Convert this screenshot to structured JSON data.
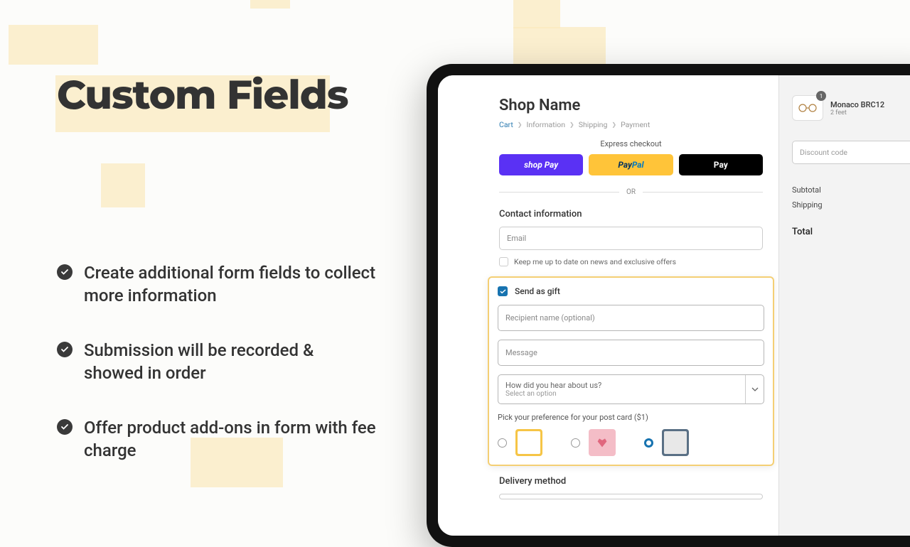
{
  "hero": {
    "title": "Custom Fields"
  },
  "bullets": [
    "Create additional form fields to collect more information",
    "Submission will be recorded & showed in order",
    "Offer product add-ons in form with fee charge"
  ],
  "checkout": {
    "shop_name": "Shop Name",
    "breadcrumb": {
      "cart": "Cart",
      "info": "Information",
      "shipping": "Shipping",
      "payment": "Payment"
    },
    "express_title": "Express checkout",
    "buttons": {
      "shoppay": "shop Pay",
      "paypal_p1": "Pay",
      "paypal_p2": "Pal",
      "applepay": "Pay"
    },
    "or": "OR",
    "contact_title": "Contact information",
    "email_placeholder": "Email",
    "news_label": "Keep me up to date on news and exclusive offers",
    "gift": {
      "title": "Send as gift",
      "recipient_placeholder": "Recipient name (optional)",
      "message_placeholder": "Message",
      "how_label": "How did you hear about us?",
      "how_value": "Select an option",
      "postcard_label": "Pick your preference for your post card ($1)"
    },
    "delivery_title": "Delivery method"
  },
  "order": {
    "product_name": "Monaco BRC12",
    "product_sub": "2 feet",
    "qty": "1",
    "discount_placeholder": "Discount code",
    "subtotal_label": "Subtotal",
    "shipping_label": "Shipping",
    "total_label": "Total"
  }
}
